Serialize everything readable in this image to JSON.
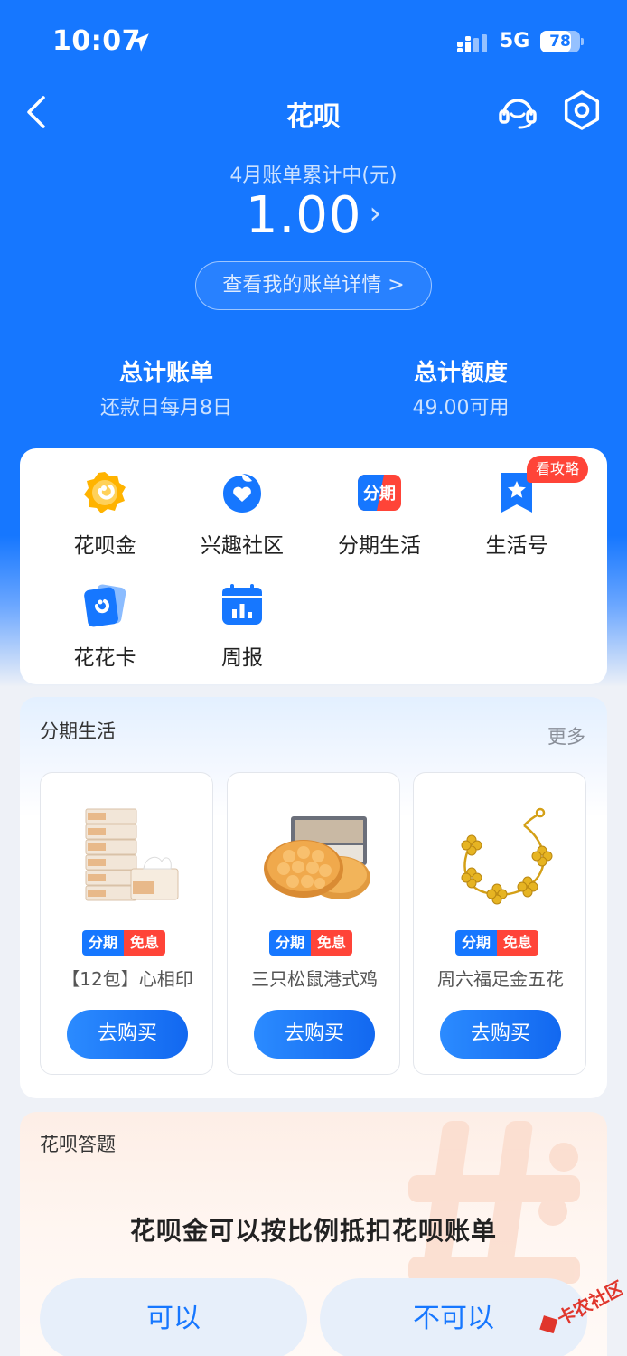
{
  "status_bar": {
    "time": "10:07",
    "network": "5G",
    "battery": "78",
    "battery_level": 0.78
  },
  "nav": {
    "title": "花呗"
  },
  "bill": {
    "label": "4月账单累计中(元)",
    "amount": "1.00",
    "detail_button": "查看我的账单详情 >"
  },
  "stats": {
    "left": {
      "title": "总计账单",
      "sub": "还款日每月8日"
    },
    "right": {
      "title": "总计额度",
      "sub": "49.00可用"
    }
  },
  "quick": {
    "badge": "看攻略",
    "items": [
      {
        "label": "花呗金",
        "icon": "huabei-gold-icon"
      },
      {
        "label": "兴趣社区",
        "icon": "community-icon"
      },
      {
        "label": "分期生活",
        "icon": "installment-icon",
        "icon_text": "分期"
      },
      {
        "label": "生活号",
        "icon": "life-account-icon"
      },
      {
        "label": "花花卡",
        "icon": "flower-card-icon"
      },
      {
        "label": "周报",
        "icon": "weekly-report-icon"
      }
    ]
  },
  "installment": {
    "title": "分期生活",
    "more": "更多",
    "tag_a": "分期",
    "tag_b": "免息",
    "products": [
      {
        "name": "【12包】心相印",
        "button": "去购买",
        "image": "tissue-boxes-image"
      },
      {
        "name": "三只松鼠港式鸡",
        "button": "去购买",
        "image": "egg-waffle-snack-image"
      },
      {
        "name": "周六福足金五花",
        "button": "去购买",
        "image": "gold-bracelet-image"
      }
    ]
  },
  "quiz": {
    "title": "花呗答题",
    "question": "花呗金可以按比例抵扣花呗账单",
    "yes": "可以",
    "no": "不可以"
  },
  "colors": {
    "brand": "#1677ff",
    "red": "#ff4438"
  }
}
